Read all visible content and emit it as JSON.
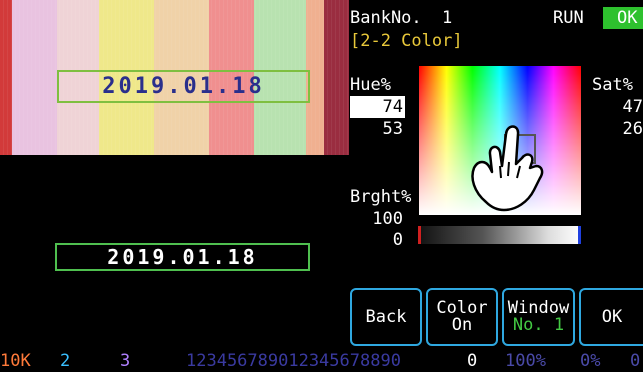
{
  "preview": {
    "date_top": "2019.01.18",
    "date_bottom": "2019.01.18",
    "color_bars": [
      "#d23a3a",
      "#e9c3e0",
      "#efd3d6",
      "#efe88a",
      "#f0d2a8",
      "#f08f8f",
      "#b8e2b0",
      "#f0b090",
      "#9a2d40"
    ]
  },
  "panel": {
    "bank_label": "BankNo.",
    "bank_number": "1",
    "run_status": "RUN",
    "ok_status": "OK",
    "mode": "[2-2 Color]",
    "hue_label": "Hue%",
    "hue_value": "74",
    "hue_value_2": "53",
    "sat_label": "Sat%",
    "sat_value": "47",
    "sat_value_2": "26",
    "brightness_label": "Brght%",
    "brightness_value": "100",
    "brightness_value_2": "0"
  },
  "buttons": {
    "back": "Back",
    "color_line1": "Color",
    "color_line2": "On",
    "window_line1": "Window",
    "window_line2": "No. 1",
    "ok": "OK"
  },
  "bottom_bar": {
    "ok_indicator": "10K",
    "marker_2": "2",
    "marker_3": "3",
    "digits": "123456789012345678890",
    "value_0": "0",
    "percent_100": "100%",
    "percent_0": "0%",
    "trailing": "0"
  },
  "colors": {
    "accent_blue": "#2fa8e0",
    "ok_green": "#2ec12e",
    "mode_yellow": "#e8c83a"
  },
  "icons": {
    "hand": "pointing-hand-icon"
  }
}
